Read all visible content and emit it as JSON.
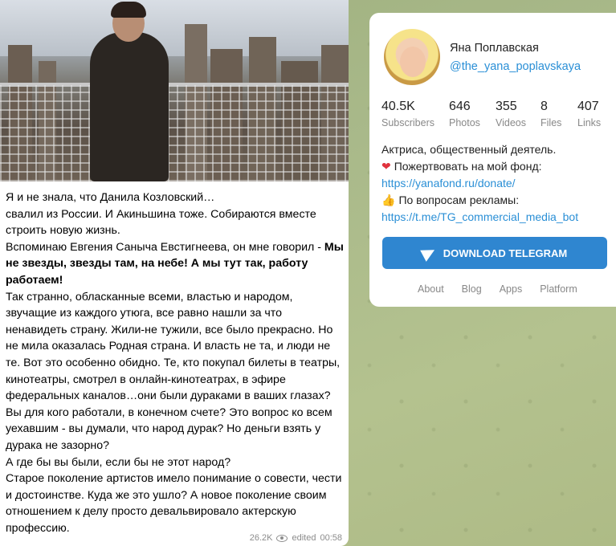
{
  "message": {
    "paragraphs": [
      {
        "text": "Я и не знала, что Данила Козловский…"
      },
      {
        "text": "свалил из России. И Акиньшина тоже. Собираются вместе строить новую жизнь."
      },
      {
        "text_plain": "Вспоминаю Евгения Саныча Евстигнеева, он мне говорил - ",
        "text_bold": "Мы не звезды, звезды там, на небе! А мы тут так, работу работаем!"
      },
      {
        "text": "Так странно, обласканные всеми, властью и народом, звучащие из каждого утюга, все равно нашли за что ненавидеть страну. Жили-не тужили, все было прекрасно. Но не мила оказалась Родная страна. И власть не та, и люди не те. Вот это особенно обидно. Те, кто покупал билеты в театры, кинотеатры, смотрел в онлайн-кинотеатрах, в эфире федеральных каналов…они были дураками в ваших глазах? Вы для кого работали, в конечном счете? Это вопрос ко всем уехавшим - вы думали, что народ дурак? Но деньги взять у дурака не зазорно?"
      },
      {
        "text": "А где бы вы были, если бы не этот народ?"
      },
      {
        "text": "Старое поколение артистов имело понимание о совести, чести и достоинстве. Куда же это ушло? А новое поколение своим отношением к делу просто девальвировало актерскую профессию."
      }
    ],
    "views": "26.2K",
    "edited_label": "edited",
    "time": "00:58"
  },
  "channel": {
    "name": "Яна Поплавская",
    "handle": "@the_yana_poplavskaya",
    "stats": [
      {
        "value": "40.5K",
        "label": "Subscribers"
      },
      {
        "value": "646",
        "label": "Photos"
      },
      {
        "value": "355",
        "label": "Videos"
      },
      {
        "value": "8",
        "label": "Files"
      },
      {
        "value": "407",
        "label": "Links"
      }
    ],
    "bio_line1": "Актриса, общественный деятель.",
    "bio_line2": "Пожертвовать на мой фонд:",
    "bio_link1": "https://yanafond.ru/donate/",
    "bio_line3": "По вопросам рекламы:",
    "bio_link2": "https://t.me/TG_commercial_media_bot",
    "heart_icon": "❤",
    "thumb_icon": "👍",
    "download_label": "DOWNLOAD TELEGRAM",
    "footer_links": [
      "About",
      "Blog",
      "Apps",
      "Platform"
    ]
  }
}
